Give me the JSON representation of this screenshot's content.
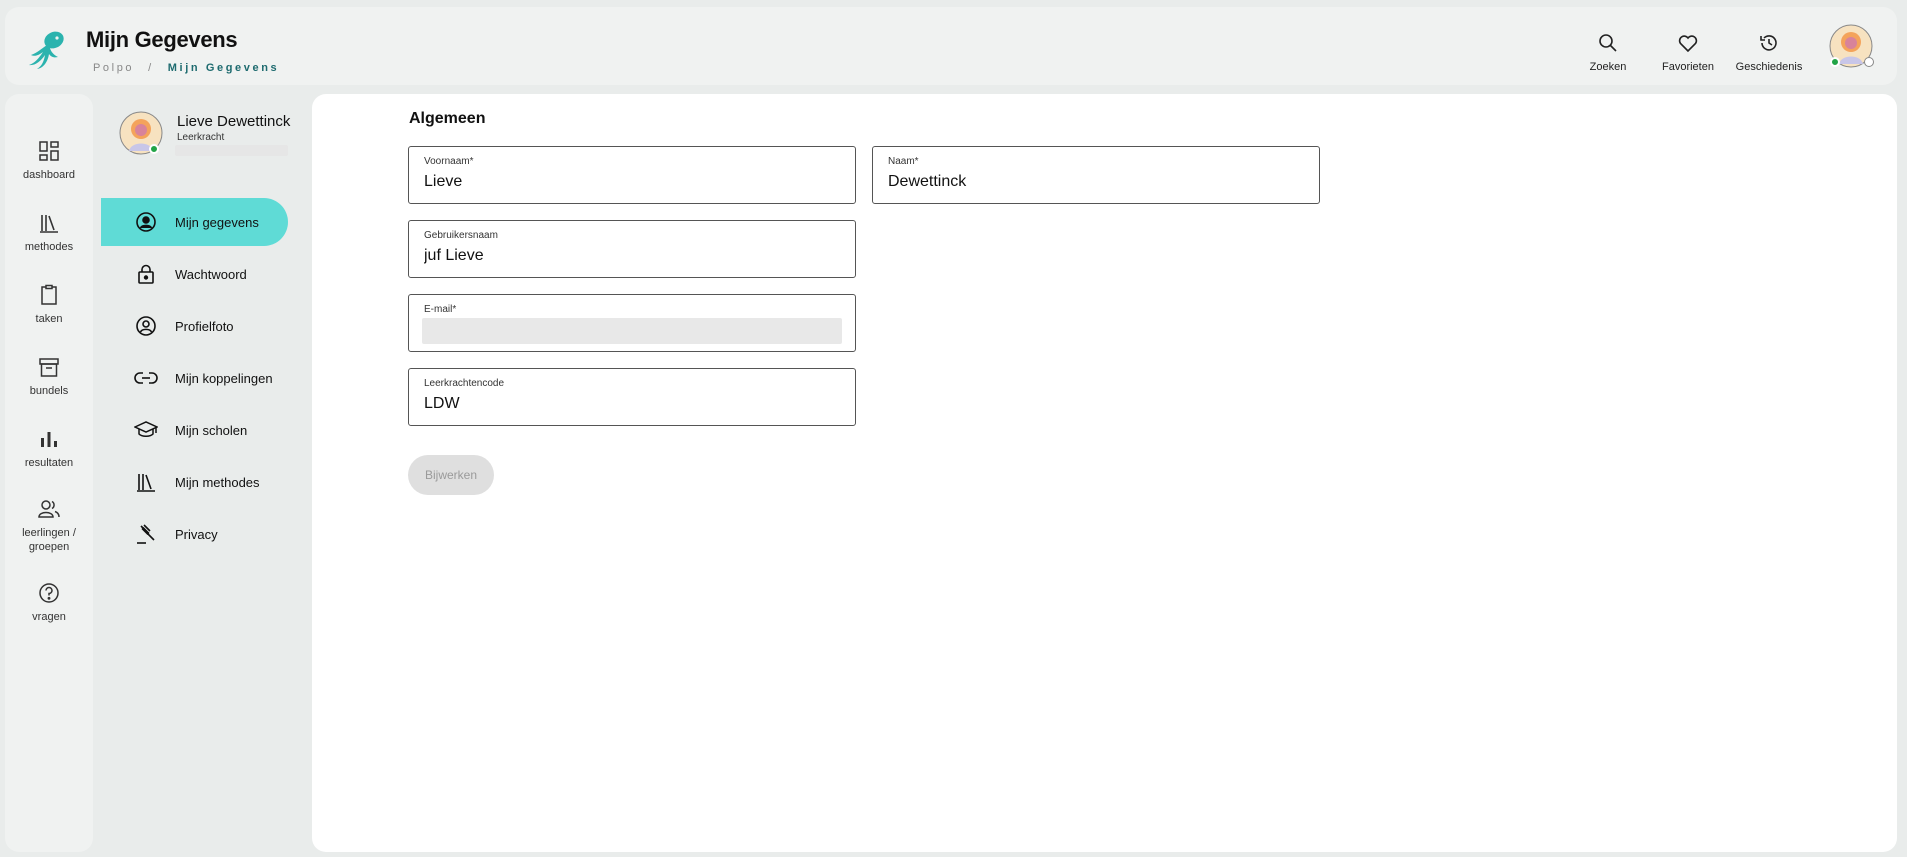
{
  "header": {
    "title": "Mijn Gegevens",
    "breadcrumb": {
      "root": "Polpo",
      "separator": "/",
      "current": "Mijn Gegevens"
    },
    "actions": [
      {
        "label": "Zoeken",
        "icon": "search-icon"
      },
      {
        "label": "Favorieten",
        "icon": "heart-icon"
      },
      {
        "label": "Geschiedenis",
        "icon": "history-icon"
      }
    ],
    "brand_color": "#2bb3ae"
  },
  "rail": {
    "items": [
      {
        "label": "dashboard",
        "icon": "dashboard-icon"
      },
      {
        "label": "methodes",
        "icon": "books-icon"
      },
      {
        "label": "taken",
        "icon": "clipboard-icon"
      },
      {
        "label": "bundels",
        "icon": "archive-icon"
      },
      {
        "label": "resultaten",
        "icon": "bar-chart-icon"
      },
      {
        "label": "leerlingen / groepen",
        "icon": "users-icon"
      },
      {
        "label": "vragen",
        "icon": "help-icon"
      }
    ]
  },
  "profile": {
    "name": "Lieve Dewettinck",
    "role": "Leerkracht",
    "status_color": "#22a447"
  },
  "menu": {
    "items": [
      {
        "label": "Mijn gegevens",
        "icon": "user-circle-icon",
        "active": true
      },
      {
        "label": "Wachtwoord",
        "icon": "lock-icon"
      },
      {
        "label": "Profielfoto",
        "icon": "account-circle-icon"
      },
      {
        "label": "Mijn koppelingen",
        "icon": "link-icon"
      },
      {
        "label": "Mijn scholen",
        "icon": "school-icon"
      },
      {
        "label": "Mijn methodes",
        "icon": "books-icon"
      },
      {
        "label": "Privacy",
        "icon": "gavel-icon"
      }
    ],
    "active_color": "#5fdbd6"
  },
  "form": {
    "section_title": "Algemeen",
    "fields": {
      "voornaam": {
        "label": "Voornaam*",
        "value": "Lieve"
      },
      "naam": {
        "label": "Naam*",
        "value": "Dewettinck"
      },
      "gebruikersnaam": {
        "label": "Gebruikersnaam",
        "value": "juf Lieve"
      },
      "email": {
        "label": "E-mail*",
        "value": ""
      },
      "leerkrachtencode": {
        "label": "Leerkrachtencode",
        "value": "LDW"
      }
    },
    "submit_label": "Bijwerken"
  }
}
